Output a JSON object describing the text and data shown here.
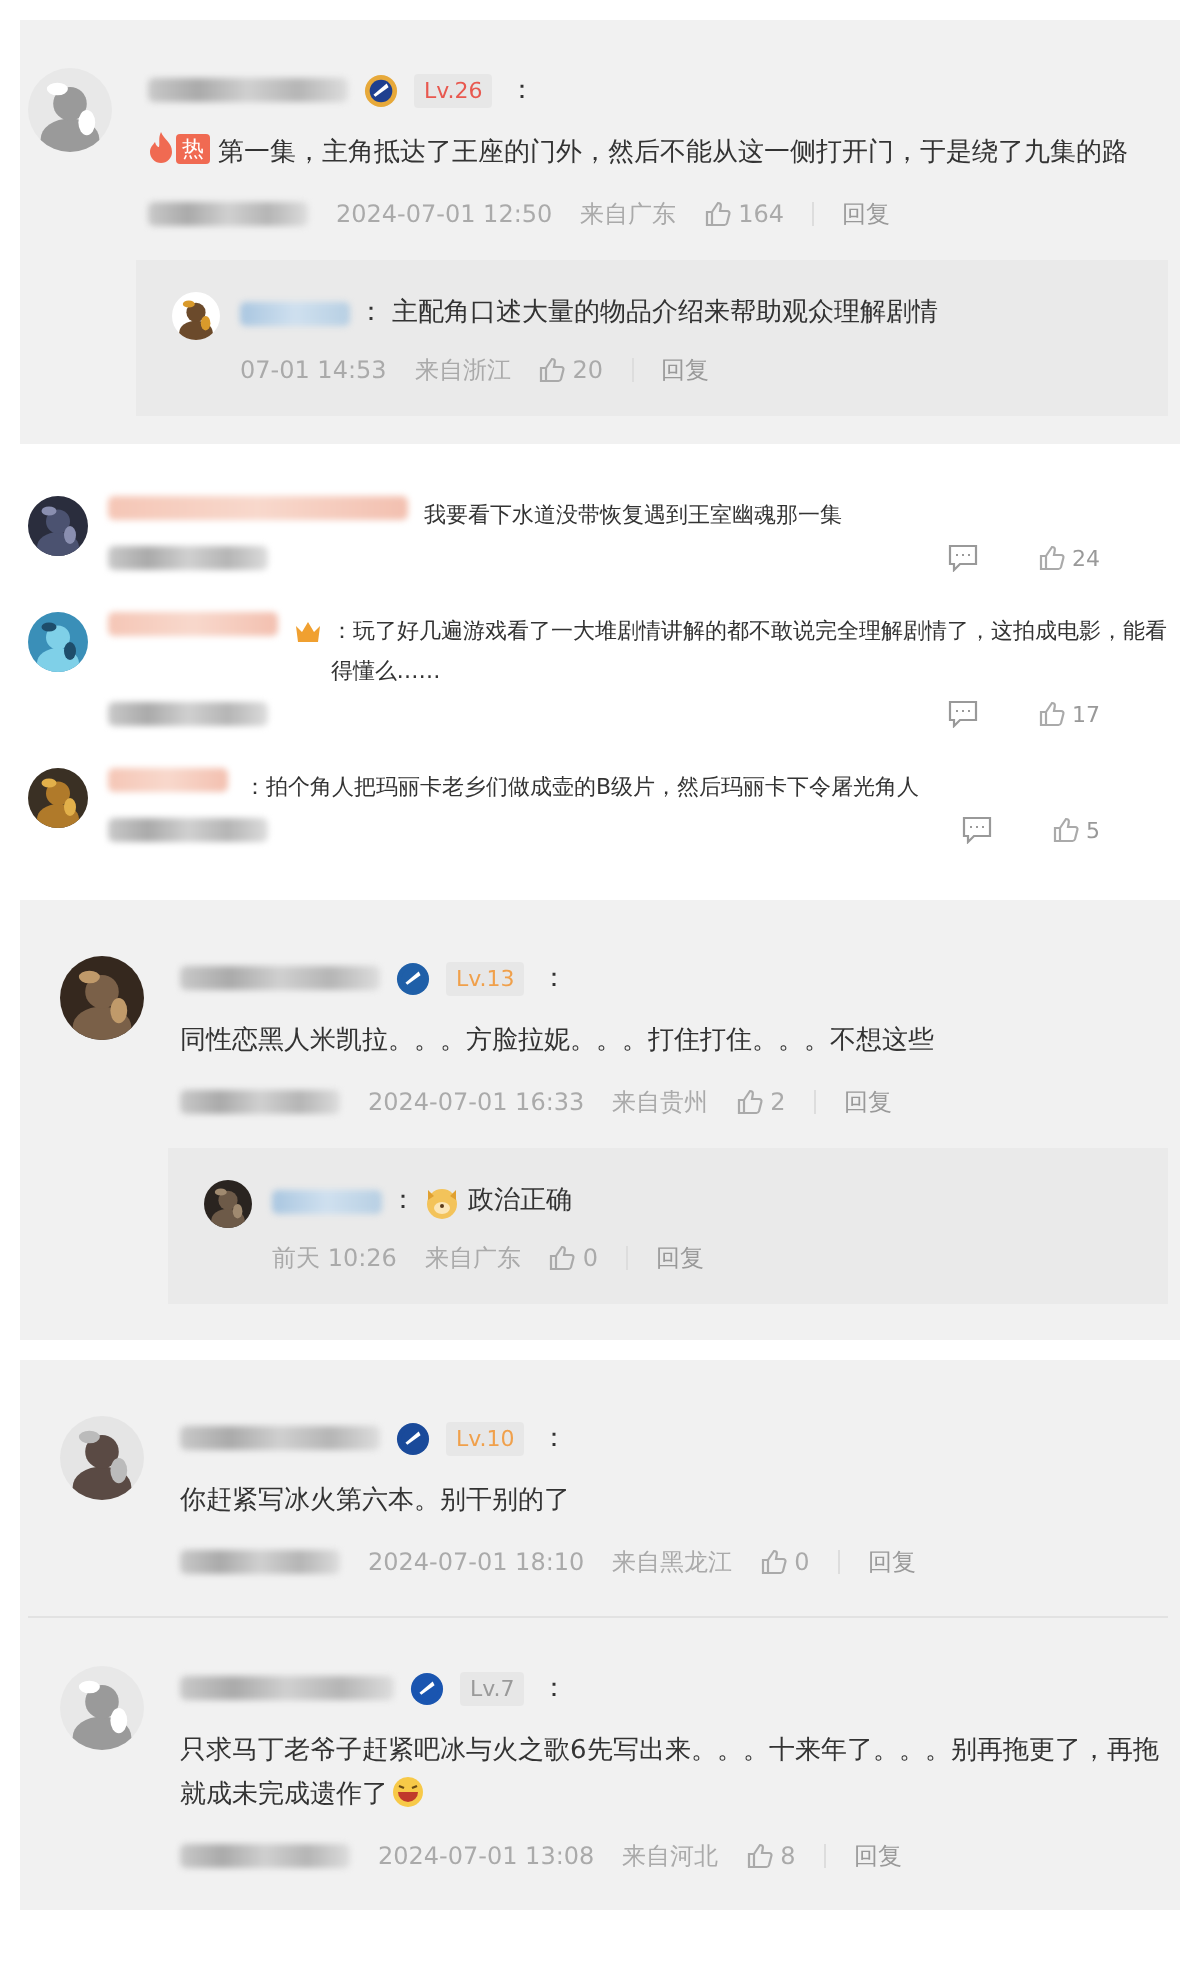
{
  "cards": [
    {
      "kind": "thread",
      "comments": [
        {
          "rank_badge": {
            "text": "Lv.26",
            "color": "#e8584f"
          },
          "separator": "：",
          "hot_badge": "热",
          "text": "第一集，主角抵达了王座的门外，然后不能从这一侧打开门，于是绕了九集的路",
          "date": "2024-07-01 12:50",
          "region": "来自广东",
          "likes": "164",
          "reply": "回复",
          "replies": [
            {
              "separator": "：",
              "text": "主配角口述大量的物品介绍来帮助观众理解剧情",
              "date": "07-01 14:53",
              "region": "来自浙江",
              "likes": "20",
              "reply": "回复"
            }
          ]
        }
      ]
    },
    {
      "kind": "list",
      "items": [
        {
          "text": "我要看下水道没带恢复遇到王室幽魂那一集",
          "likes": "24"
        },
        {
          "crown": true,
          "text": "：玩了好几遍游戏看了一大堆剧情讲解的都不敢说完全理解剧情了，这拍成电影，能看得懂么……",
          "likes": "17"
        },
        {
          "text": "：拍个角人把玛丽卡老乡们做成壶的B级片，然后玛丽卡下令屠光角人",
          "likes": "5"
        }
      ]
    },
    {
      "kind": "thread",
      "comments": [
        {
          "rank_badge": {
            "text": "Lv.13",
            "color": "#f0a04b"
          },
          "separator": "：",
          "text": "同性恋黑人米凯拉。。。方脸拉妮。。。打住打住。。。不想这些",
          "date": "2024-07-01 16:33",
          "region": "来自贵州",
          "likes": "2",
          "reply": "回复",
          "replies": [
            {
              "separator": "：",
              "emoji": true,
              "text": "政治正确",
              "date": "前天 10:26",
              "region": "来自广东",
              "likes": "0",
              "reply": "回复"
            }
          ]
        }
      ]
    },
    {
      "kind": "thread",
      "comments": [
        {
          "rank_badge": {
            "text": "Lv.10",
            "color": "#f0a04b"
          },
          "separator": "：",
          "text": "你赶紧写冰火第六本。别干别的了",
          "date": "2024-07-01 18:10",
          "region": "来自黑龙江",
          "likes": "0",
          "reply": "回复"
        },
        {
          "rank_badge": {
            "text": "Lv.7",
            "color": "#9a9a9a"
          },
          "separator": "：",
          "text": "只求马丁老爷子赶紧吧冰与火之歌6先写出来。。。十来年了。。。别再拖更了，再拖就成未完成遗作了",
          "laugh_emoji": true,
          "date": "2024-07-01 13:08",
          "region": "来自河北",
          "likes": "8",
          "reply": "回复"
        }
      ]
    }
  ]
}
